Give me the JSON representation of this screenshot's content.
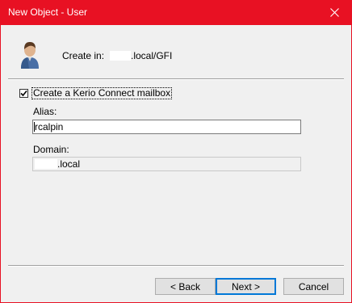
{
  "window": {
    "title": "New Object - User",
    "close_icon": "close-icon"
  },
  "header": {
    "icon": "user-icon",
    "create_in_label": "Create in:",
    "create_in_value": ".local/GFI"
  },
  "mailbox": {
    "checkbox_checked": true,
    "checkbox_label": "Create a Kerio Connect mailbox",
    "alias_label": "Alias:",
    "alias_value": "rcalpin",
    "domain_label": "Domain:",
    "domain_value": ".local"
  },
  "buttons": {
    "back": "< Back",
    "next": "Next >",
    "cancel": "Cancel"
  }
}
